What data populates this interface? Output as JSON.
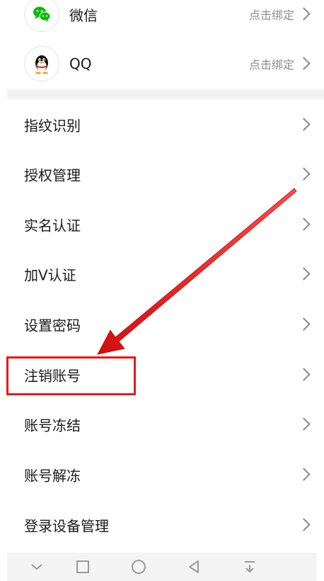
{
  "bindings": [
    {
      "name": "微信",
      "icon": "wechat-icon",
      "action": "点击绑定",
      "color": "#09bb07"
    },
    {
      "name": "QQ",
      "icon": "qq-icon",
      "action": "点击绑定",
      "color": "#000000"
    }
  ],
  "menu": [
    {
      "label": "指纹识别"
    },
    {
      "label": "授权管理"
    },
    {
      "label": "实名认证"
    },
    {
      "label": "加V认证"
    },
    {
      "label": "设置密码"
    },
    {
      "label": "注销账号"
    },
    {
      "label": "账号冻结"
    },
    {
      "label": "账号解冻"
    },
    {
      "label": "登录设备管理"
    }
  ],
  "annotation": {
    "highlighted_item": "注销账号",
    "color": "#e31b1b"
  },
  "navbar": {
    "icons": [
      "chevron-down-icon",
      "recent-apps-icon",
      "home-icon",
      "back-icon",
      "notification-pull-down-icon"
    ]
  }
}
